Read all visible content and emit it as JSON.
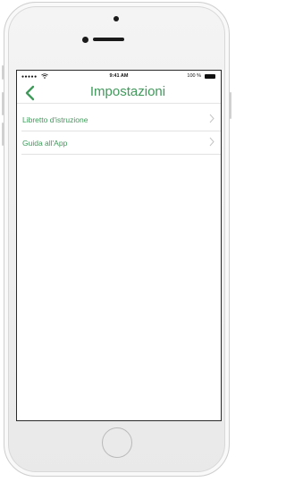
{
  "colors": {
    "accent": "#3f9a5a",
    "divider": "#e2e2e2",
    "chevron": "#c4c4c4"
  },
  "status_bar": {
    "signal": "●●●●●",
    "wifi_icon": "wifi-icon",
    "time": "9:41 AM",
    "battery_percent": "100 %",
    "battery_icon": "battery-icon"
  },
  "nav": {
    "back_icon": "chevron-left-icon",
    "title": "Impostazioni"
  },
  "settings_list": {
    "items": [
      {
        "label": "Libretto d'istruzione",
        "icon": "chevron-right-icon"
      },
      {
        "label": "Guida all'App",
        "icon": "chevron-right-icon"
      }
    ]
  }
}
